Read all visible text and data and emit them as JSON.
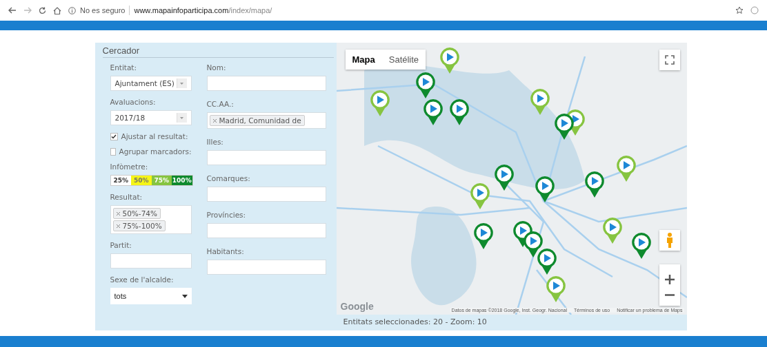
{
  "browser": {
    "security": "No es seguro",
    "url_host": "www.mapainfoparticipa.com",
    "url_path": "/index/mapa/"
  },
  "search_panel": {
    "title": "Cercador",
    "left_fields": [
      {
        "kind": "combo",
        "label": "Entitat:",
        "value": "Ajuntament (ES)"
      },
      {
        "kind": "combo",
        "label": "Avaluacions:",
        "value": "2017/18"
      },
      {
        "kind": "checkbox",
        "label": "Ajustar al resultat:",
        "checked": true
      },
      {
        "kind": "checkbox",
        "label": "Agrupar marcadors:",
        "checked": false
      },
      {
        "kind": "legend",
        "label": "Infòmetre:",
        "segments": [
          {
            "text": "25%",
            "color": "#ffffff"
          },
          {
            "text": "50%",
            "color": "#f5f516"
          },
          {
            "text": "75%",
            "color": "#86c440"
          },
          {
            "text": "100%",
            "color": "#0e8a2e"
          }
        ]
      },
      {
        "kind": "tags",
        "label": "Resultat:",
        "tags": [
          "50%-74%",
          "75%-100%"
        ]
      },
      {
        "kind": "input",
        "label": "Partit:"
      },
      {
        "kind": "dropdown",
        "label": "Sexe de l'alcalde:",
        "value": "tots"
      }
    ],
    "right_fields": [
      {
        "kind": "input",
        "label": "Nom:"
      },
      {
        "kind": "tags",
        "label": "CC.AA.:",
        "tags": [
          "Madrid, Comunidad de"
        ]
      },
      {
        "kind": "input",
        "label": "Illes:"
      },
      {
        "kind": "input",
        "label": "Comarques:"
      },
      {
        "kind": "input",
        "label": "Províncies:"
      },
      {
        "kind": "input",
        "label": "Habitants:"
      }
    ]
  },
  "map": {
    "map_types": [
      {
        "label": "Mapa",
        "selected": true
      },
      {
        "label": "Satélite",
        "selected": false
      }
    ],
    "markers": [
      {
        "color": "#86c440"
      },
      {
        "color": "#0e8a2e"
      },
      {
        "color": "#86c440"
      },
      {
        "color": "#0e8a2e"
      },
      {
        "color": "#0e8a2e"
      },
      {
        "color": "#86c440"
      },
      {
        "color": "#86c440"
      },
      {
        "color": "#0e8a2e"
      },
      {
        "color": "#86c440"
      },
      {
        "color": "#0e8a2e"
      },
      {
        "color": "#86c440"
      },
      {
        "color": "#0e8a2e"
      },
      {
        "color": "#0e8a2e"
      },
      {
        "color": "#0e8a2e"
      },
      {
        "color": "#0e8a2e"
      },
      {
        "color": "#0e8a2e"
      },
      {
        "color": "#86c440"
      },
      {
        "color": "#0e8a2e"
      },
      {
        "color": "#0e8a2e"
      },
      {
        "color": "#86c440"
      }
    ],
    "logo": "Google",
    "attribution": "Datos de mapas ©2018 Google, Inst. Geogr. Nacional",
    "terms": "Términos de uso",
    "report": "Notificar un problema de Maps"
  },
  "status": "Entitats seleccionades: 20 - Zoom: 10"
}
